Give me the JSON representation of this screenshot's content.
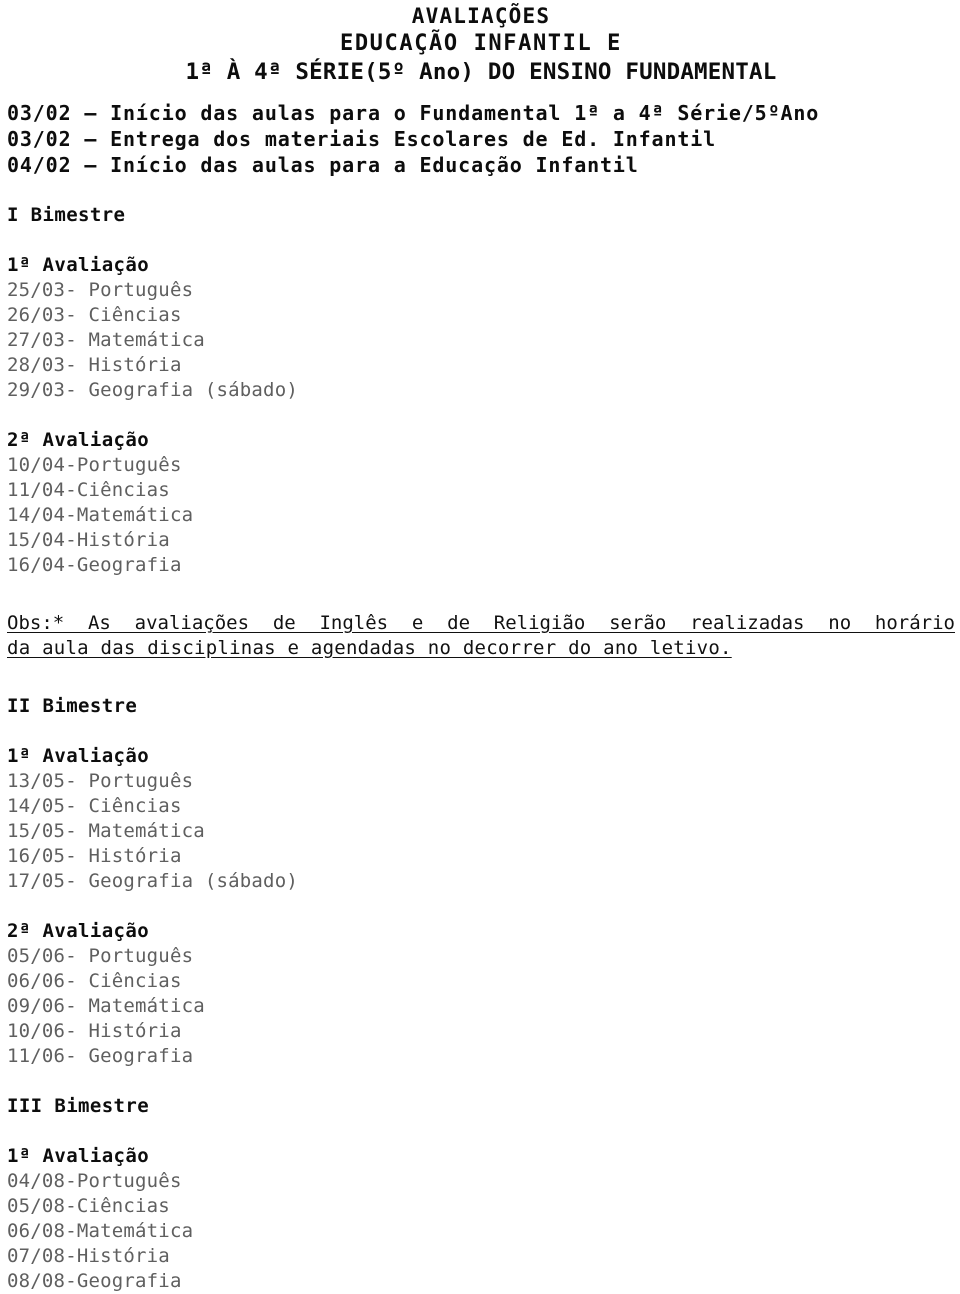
{
  "document": {
    "title_lines": [
      "AVALIAÇÕES",
      "EDUCAÇÃO INFANTIL E",
      "1ª À 4ª SÉRIE(5º Ano) DO ENSINO FUNDAMENTAL"
    ],
    "intro_lines": [
      "03/02 – Início das aulas para o Fundamental 1ª a 4ª Série/5ºAno",
      "03/02 – Entrega dos materiais Escolares de Ed. Infantil",
      "04/02 – Início das aulas para a Educação Infantil"
    ],
    "observation": {
      "line1": "Obs:* As avaliações de Inglês e de Religião serão realizadas no horário",
      "line2": "da aula das disciplinas e agendadas no decorrer do ano letivo."
    },
    "bimestres": [
      {
        "heading": "I Bimestre",
        "avaliacoes": [
          {
            "heading": "1ª Avaliação",
            "entries": [
              "25/03- Português",
              "26/03- Ciências",
              "27/03- Matemática",
              "28/03- História",
              "29/03- Geografia (sábado)"
            ]
          },
          {
            "heading": "2ª Avaliação",
            "entries": [
              "10/04-Português",
              "11/04-Ciências",
              "14/04-Matemática",
              "15/04-História",
              "16/04-Geografia"
            ]
          }
        ]
      },
      {
        "heading": "II Bimestre",
        "avaliacoes": [
          {
            "heading": "1ª Avaliação",
            "entries": [
              "13/05- Português",
              "14/05- Ciências",
              "15/05- Matemática",
              "16/05- História",
              "17/05- Geografia (sábado)"
            ]
          },
          {
            "heading": "2ª Avaliação",
            "entries": [
              "05/06- Português",
              "06/06- Ciências",
              "09/06- Matemática",
              "10/06- História",
              "11/06- Geografia"
            ]
          }
        ]
      },
      {
        "heading": "III Bimestre",
        "avaliacoes": [
          {
            "heading": "1ª Avaliação",
            "entries": [
              "04/08-Português",
              "05/08-Ciências",
              "06/08-Matemática",
              "07/08-História",
              "08/08-Geografia"
            ]
          }
        ]
      }
    ],
    "colors": {
      "text_dark": "#0d0d0d",
      "text_grey": "#5f5f5f",
      "background": "#ffffff"
    }
  }
}
